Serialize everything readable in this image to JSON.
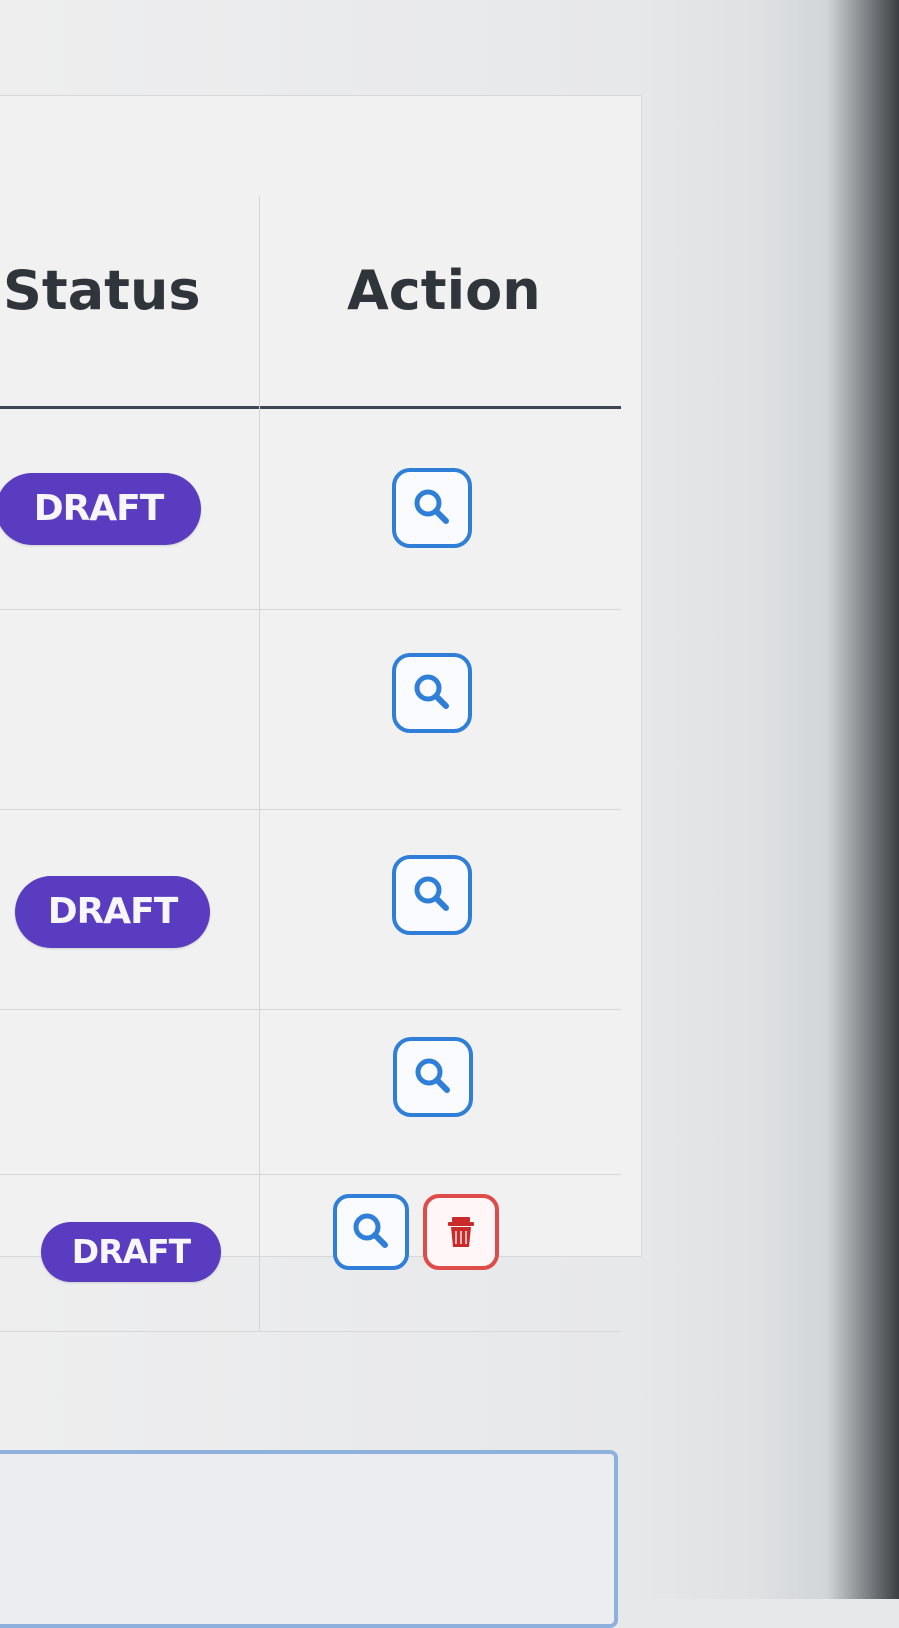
{
  "table": {
    "headers": {
      "status": "Status",
      "action": "Action"
    },
    "rows": [
      {
        "status": "DRAFT",
        "actions": [
          "search-icon"
        ]
      },
      {
        "status": "",
        "actions": [
          "search-icon"
        ]
      },
      {
        "status": "DRAFT",
        "actions": [
          "search-icon"
        ]
      },
      {
        "status": "",
        "actions": [
          "search-icon"
        ]
      },
      {
        "status": "DRAFT",
        "actions": [
          "search-icon",
          "trash-icon"
        ]
      }
    ]
  },
  "colors": {
    "draft_badge": "#5a3cc0",
    "view_button": "#2f7ed8",
    "delete_button": "#df4b48"
  }
}
